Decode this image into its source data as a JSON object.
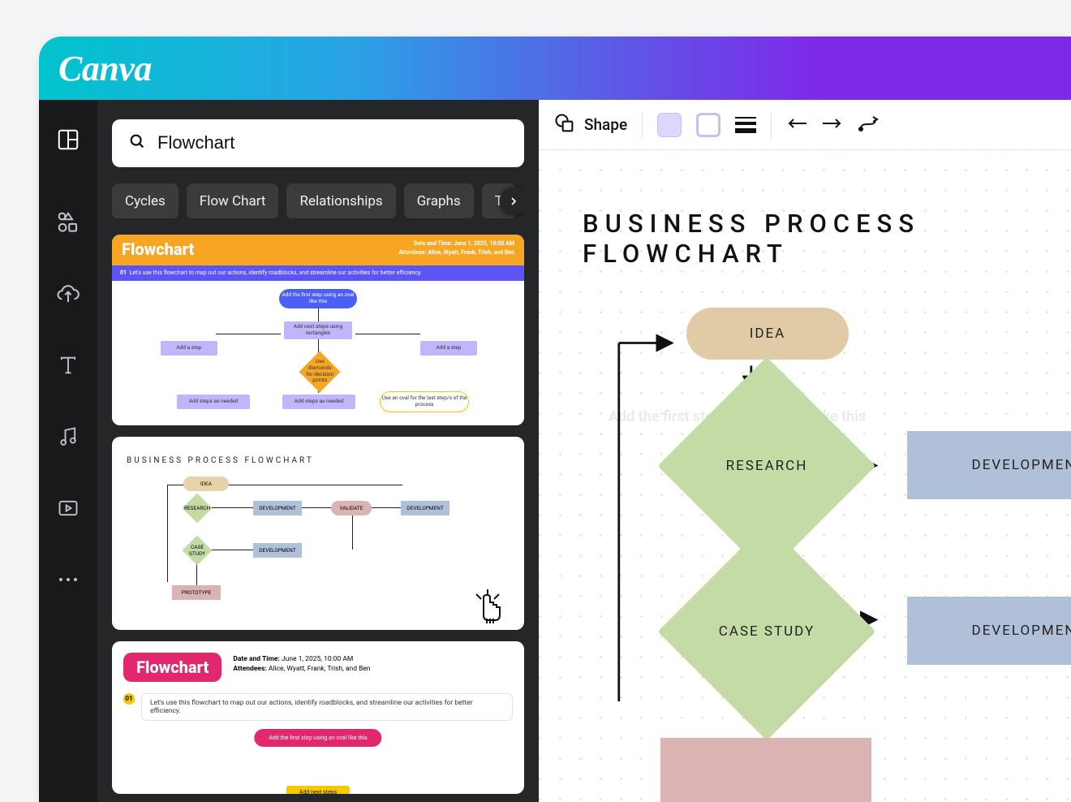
{
  "brand": "Canva",
  "toolbar": {
    "shape_label": "Shape"
  },
  "search": {
    "value": "Flowchart"
  },
  "chips": [
    "Cycles",
    "Flow Chart",
    "Relationships",
    "Graphs",
    "T"
  ],
  "canvas": {
    "title": "BUSINESS PROCESS FLOWCHART",
    "nodes": {
      "idea": "IDEA",
      "research": "RESEARCH",
      "dev1": "DEVELOPMENT",
      "case_study": "CASE STUDY",
      "dev2": "DEVELOPMENT"
    },
    "faint": "Add the first step\nusing an oval like this"
  },
  "template1": {
    "title": "Flowchart",
    "meta1": "Date and Time: June 1, 2025, 10:00 AM",
    "meta2": "Attendees: Alice, Wyatt, Frank, Trish, and Ben",
    "banner_prefix": "01",
    "banner": "Let's use this flowchart to map out our actions, identify roadblocks, and streamline our activities for better efficiency.",
    "n_oval1": "Add the first step using an oval like this",
    "n_rect1": "Add next steps using rectangles",
    "n_rectL": "Add a step",
    "n_rectR": "Add a step",
    "n_dia": "Use diamonds for decision points",
    "n_rectBL": "Add steps as needed",
    "n_rectBM": "Add steps as needed",
    "n_oval2": "Use an oval for the last step/s of the process"
  },
  "template2": {
    "title": "BUSINESS PROCESS FLOWCHART",
    "idea": "IDEA",
    "research": "RESEARCH",
    "dev": "DEVELOPMENT",
    "validate": "VALIDATE",
    "dev2": "DEVELOPMENT",
    "case_study": "CASE STUDY",
    "dev3": "DEVELOPMENT",
    "prototype": "PROTOTYPE"
  },
  "template3": {
    "badge": "Flowchart",
    "meta1_label": "Date and Time:",
    "meta1_val": "June 1, 2025, 10:00 AM",
    "meta2_label": "Attendees:",
    "meta2_val": "Alice, Wyatt, Frank, Trish, and Ben",
    "num": "01",
    "box": "Let's use this flowchart to map out our actions, identify roadblocks, and streamline our activities for better efficiency.",
    "oval": "Add the first step using an oval like this",
    "rect": "Add next steps"
  }
}
